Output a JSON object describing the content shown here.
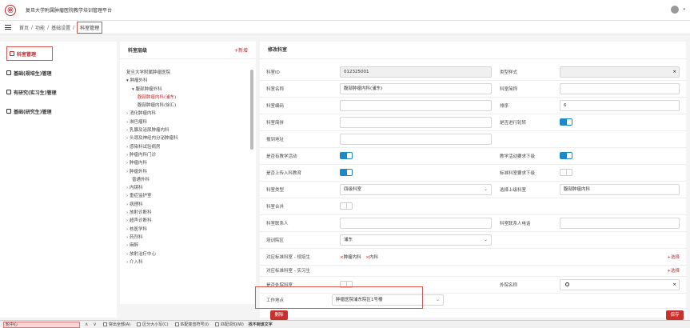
{
  "header": {
    "logo_glyph": "㊥",
    "title": "复旦大学附属肿瘤医院教学培训管理平台"
  },
  "breadcrumb": {
    "items": [
      "首页",
      "/",
      "功能",
      "/",
      "基础设置",
      "/"
    ],
    "current": "科室管理"
  },
  "sidebar": {
    "items": [
      {
        "label": "科室管理",
        "icon": "building-icon",
        "active": true
      },
      {
        "label": "基础(规培生)管理",
        "icon": "monitor-icon",
        "active": false
      },
      {
        "label": "有研究(实习生)管理",
        "icon": "bank-icon",
        "active": false
      },
      {
        "label": "基础(研究生)管理",
        "icon": "bank-icon",
        "active": false
      }
    ]
  },
  "tree_panel": {
    "title": "科室层级",
    "add_label": "+新增",
    "nodes": [
      {
        "label": "复旦大学附属肿瘤医院",
        "indent": 0,
        "red": false
      },
      {
        "label": "▾ 肿瘤外科",
        "indent": 0,
        "red": false
      },
      {
        "label": "▾ 腹部肿瘤外科",
        "indent": 1,
        "red": false
      },
      {
        "label": "腹部肿瘤内科(浦东)",
        "indent": 2,
        "red": true
      },
      {
        "label": "腹部肿瘤内科(徐汇)",
        "indent": 2,
        "red": false
      },
      {
        "label": "› 消化肿瘤内科",
        "indent": 0,
        "red": false
      },
      {
        "label": "› 淋巴瘤科",
        "indent": 0,
        "red": false
      },
      {
        "label": "› 乳腺及泌尿肿瘤内科",
        "indent": 0,
        "red": false
      },
      {
        "label": "› 头颈及神经内分泌肿瘤科",
        "indent": 0,
        "red": false
      },
      {
        "label": "› 感染科试验病房",
        "indent": 0,
        "red": false
      },
      {
        "label": "› 肿瘤内科门诊",
        "indent": 0,
        "red": false
      },
      {
        "label": "› 肿瘤内科",
        "indent": 0,
        "red": false
      },
      {
        "label": "› 肿瘤外科",
        "indent": 0,
        "red": false
      },
      {
        "label": "普通外科",
        "indent": 1,
        "red": false
      },
      {
        "label": "› 内镜科",
        "indent": 0,
        "red": false
      },
      {
        "label": "› 重症监护室",
        "indent": 0,
        "red": false
      },
      {
        "label": "› 病理科",
        "indent": 0,
        "red": false
      },
      {
        "label": "› 放射诊断科",
        "indent": 0,
        "red": false
      },
      {
        "label": "› 超声诊断科",
        "indent": 0,
        "red": false
      },
      {
        "label": "› 核医学科",
        "indent": 0,
        "red": false
      },
      {
        "label": "› 药剂科",
        "indent": 0,
        "red": false
      },
      {
        "label": "› 麻醉",
        "indent": 0,
        "red": false
      },
      {
        "label": "› 放射治疗中心",
        "indent": 0,
        "red": false
      },
      {
        "label": "› 介入科",
        "indent": 0,
        "red": false
      }
    ]
  },
  "form": {
    "title": "修改科室",
    "dept_id_label": "科室ID",
    "dept_id": "012325001",
    "dept_type_label": "类型样式",
    "dept_name_label": "科室名称",
    "dept_name": "腹部肿瘤内科(浦东)",
    "dept_short_label": "科室简称",
    "dept_code_label": "科室编码",
    "sort_label": "排序",
    "sort_value": "6",
    "dept_abbr_label": "科室简拼",
    "rotation_label": "是否进行轮转",
    "sub_address_label": "报到地址",
    "teaching_label": "是否有教学活动",
    "teaching_lower_label": "教学活动要求下级",
    "upload_label": "是否上传入科教育",
    "std_lower_label": "标准科室要求下级",
    "dept_type2_label": "科室类型",
    "dept_type2": "四级科室",
    "parent_label": "选择上级科室",
    "parent_value": "腹部肿瘤内科",
    "merge_label": "科室合并",
    "contact_label": "科室联系人",
    "contact_phone_label": "科室联系人电话",
    "campus_label": "培训院区",
    "campus_value": "浦东",
    "std_dept_res_label": "对应标准科室 - 规培生",
    "std_dept_res_tags": [
      "肿瘤内科",
      "内科"
    ],
    "std_dept_res_add": "+选择",
    "std_dept_intern_label": "对应标准科室 - 实习生",
    "std_dept_intern_add": "+选择",
    "external_label": "是否外院科室",
    "external_name_label": "外院名称",
    "workplace_label": "工作地点",
    "workplace_value": "肿瘤医院浦东院区1号楼",
    "left_button": "删除",
    "right_button": "保存"
  },
  "findbar": {
    "query": "轮中心",
    "opt_highlight": "突出全部(A)",
    "opt_case": "区分大小写(C)",
    "opt_diacritics": "匹配变音符号(I)",
    "opt_whole": "匹配词句(W)",
    "status": "找不到该文字"
  }
}
